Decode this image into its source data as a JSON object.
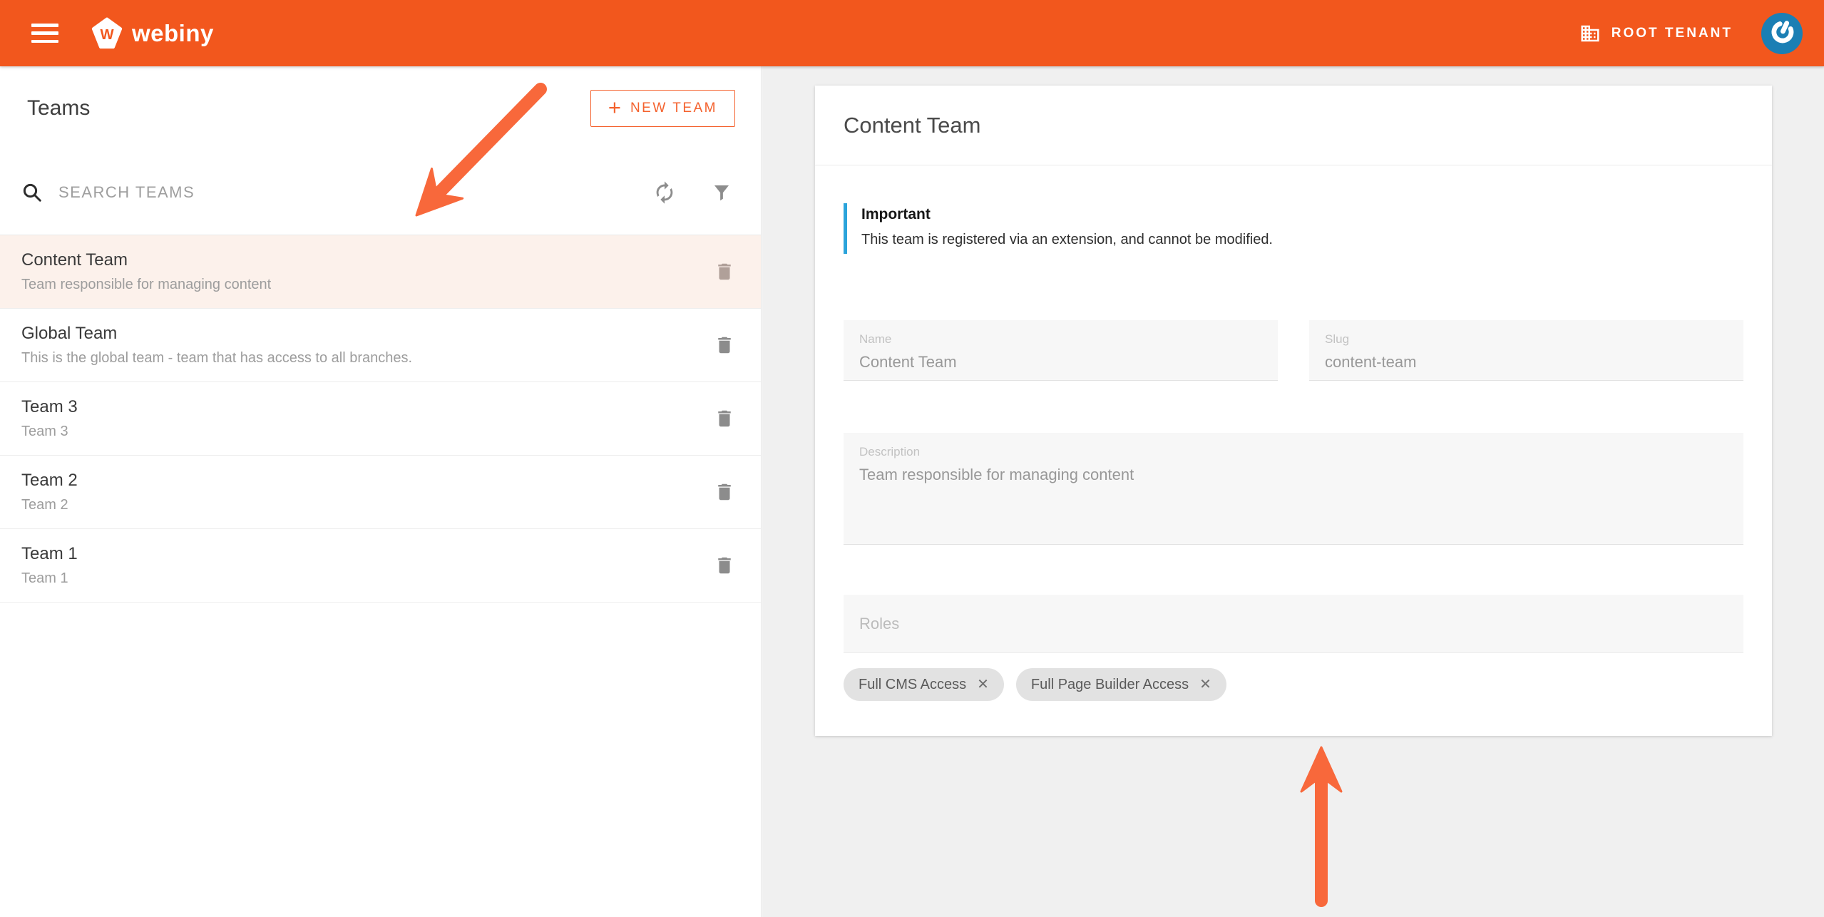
{
  "header": {
    "brand": "webiny",
    "brand_initial": "W",
    "tenant_label": "ROOT TENANT"
  },
  "teams_panel": {
    "title": "Teams",
    "new_team_button": {
      "icon": "+",
      "label": "NEW TEAM"
    },
    "search_placeholder": "SEARCH TEAMS",
    "teams": [
      {
        "name": "Content Team",
        "description": "Team responsible for managing content",
        "selected": true
      },
      {
        "name": "Global Team",
        "description": "This is the global team - team that has access to all branches.",
        "selected": false
      },
      {
        "name": "Team 3",
        "description": "Team 3",
        "selected": false
      },
      {
        "name": "Team 2",
        "description": "Team 2",
        "selected": false
      },
      {
        "name": "Team 1",
        "description": "Team 1",
        "selected": false
      }
    ]
  },
  "detail": {
    "title": "Content Team",
    "notice": {
      "title": "Important",
      "text": "This team is registered via an extension, and cannot be modified."
    },
    "fields": {
      "name": {
        "label": "Name",
        "value": "Content Team"
      },
      "slug": {
        "label": "Slug",
        "value": "content-team"
      },
      "description": {
        "label": "Description",
        "value": "Team responsible for managing content"
      },
      "roles": {
        "label": "Roles",
        "chips": [
          "Full CMS Access",
          "Full Page Builder Access"
        ]
      }
    },
    "chip_close_glyph": "✕"
  },
  "colors": {
    "header_bg": "#F2571D",
    "accent": "#F4622E",
    "arrow": "#F8683B",
    "selected_row_bg": "#FCF1EB",
    "notice_bar": "#2BA4DB",
    "avatar_bg": "#1B7FB4"
  }
}
